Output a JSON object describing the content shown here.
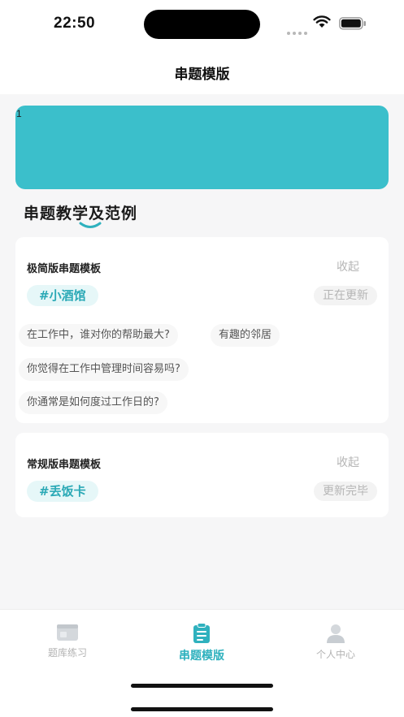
{
  "status_bar": {
    "time": "22:50"
  },
  "nav": {
    "title": "串题模版"
  },
  "banner": {
    "index_label": "1",
    "color": "#3bbfcb"
  },
  "section": {
    "title": "串题教学及范例"
  },
  "cards": [
    {
      "title": "极简版串题模板",
      "collapse_label": "收起",
      "tag": "#小酒馆",
      "status": "正在更新",
      "questions": [
        "在工作中，谁对你的帮助最大?",
        "有趣的邻居",
        "你觉得在工作中管理时间容易吗?",
        "你通常是如何度过工作日的?"
      ]
    },
    {
      "title": "常规版串题模板",
      "collapse_label": "收起",
      "tag": "#丢饭卡",
      "status": "更新完毕"
    }
  ],
  "tabs": [
    {
      "label": "题库练习",
      "icon": "image-icon",
      "active": false
    },
    {
      "label": "串题模版",
      "icon": "document-icon",
      "active": true
    },
    {
      "label": "个人中心",
      "icon": "user-icon",
      "active": false
    }
  ],
  "colors": {
    "accent": "#2fb1be",
    "inactive": "#b3b3b3"
  }
}
